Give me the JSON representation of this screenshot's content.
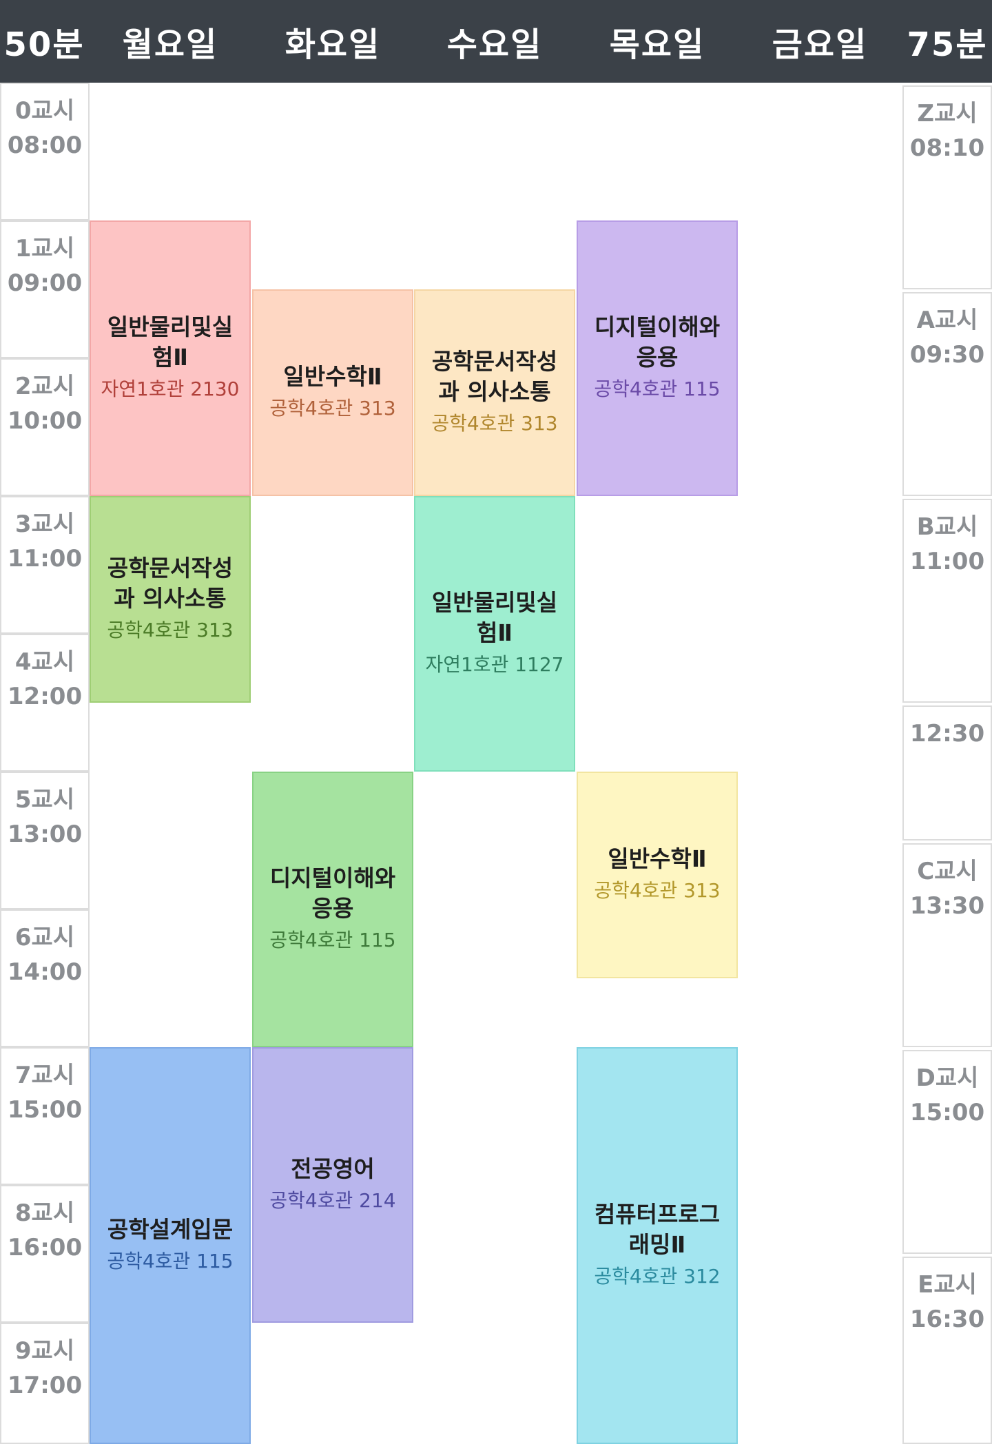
{
  "header": {
    "left_label": "50분",
    "days": [
      "월요일",
      "화요일",
      "수요일",
      "목요일",
      "금요일"
    ],
    "right_label": "75분"
  },
  "left_periods": [
    {
      "name": "0교시",
      "time": "08:00"
    },
    {
      "name": "1교시",
      "time": "09:00"
    },
    {
      "name": "2교시",
      "time": "10:00"
    },
    {
      "name": "3교시",
      "time": "11:00"
    },
    {
      "name": "4교시",
      "time": "12:00"
    },
    {
      "name": "5교시",
      "time": "13:00"
    },
    {
      "name": "6교시",
      "time": "14:00"
    },
    {
      "name": "7교시",
      "time": "15:00"
    },
    {
      "name": "8교시",
      "time": "16:00"
    },
    {
      "name": "9교시",
      "time": "17:00"
    }
  ],
  "right_periods": [
    {
      "name": "Z교시",
      "time": "08:10"
    },
    {
      "name": "A교시",
      "time": "09:30"
    },
    {
      "name": "B교시",
      "time": "11:00"
    },
    {
      "name": "",
      "time": "12:30"
    },
    {
      "name": "C교시",
      "time": "13:30"
    },
    {
      "name": "D교시",
      "time": "15:00"
    },
    {
      "name": "E교시",
      "time": "16:30"
    }
  ],
  "courses": [
    {
      "day": "월요일",
      "title": "일반물리및실험Ⅱ",
      "room": "자연1호관 2130",
      "start": "09:00",
      "end": "11:00",
      "bg": "#fdc4c4",
      "border": "#f3a7a7",
      "text_color": "#b0403a"
    },
    {
      "day": "화요일",
      "title": "일반수학Ⅱ",
      "room": "공학4호관 313",
      "start": "09:30",
      "end": "11:00",
      "bg": "#fed7c3",
      "border": "#f5c2a6",
      "text_color": "#b0613a"
    },
    {
      "day": "수요일",
      "title": "공학문서작성과 의사소통",
      "room": "공학4호관 313",
      "start": "09:30",
      "end": "11:00",
      "bg": "#fde7c4",
      "border": "#f5d6a4",
      "text_color": "#b0862c"
    },
    {
      "day": "목요일",
      "title": "디지털이해와응용",
      "room": "공학4호관 115",
      "start": "09:00",
      "end": "11:00",
      "bg": "#ccb8f0",
      "border": "#b79de6",
      "text_color": "#6a4aa7"
    },
    {
      "day": "월요일",
      "title": "공학문서작성과 의사소통",
      "room": "공학4호관 313",
      "start": "11:00",
      "end": "12:30",
      "bg": "#b8df92",
      "border": "#9fce74",
      "text_color": "#4a7a26"
    },
    {
      "day": "수요일",
      "title": "일반물리및실험Ⅱ",
      "room": "자연1호관 1127",
      "start": "11:00",
      "end": "13:00",
      "bg": "#9eeed0",
      "border": "#7fdfbb",
      "text_color": "#2e7d5f"
    },
    {
      "day": "화요일",
      "title": "디지털이해와응용",
      "room": "공학4호관 115",
      "start": "13:00",
      "end": "15:00",
      "bg": "#a5e3a0",
      "border": "#88d284",
      "text_color": "#3e7a3a"
    },
    {
      "day": "목요일",
      "title": "일반수학Ⅱ",
      "room": "공학4호관 313",
      "start": "13:00",
      "end": "14:30",
      "bg": "#fef6c2",
      "border": "#f2e5a0",
      "text_color": "#b2972a"
    },
    {
      "day": "월요일",
      "title": "공학설계입문",
      "room": "공학4호관 115",
      "start": "15:00",
      "end": "17:55",
      "bg": "#97bff3",
      "border": "#7eaae6",
      "text_color": "#2c5aa0"
    },
    {
      "day": "화요일",
      "title": "전공영어",
      "room": "공학4호관 214",
      "start": "15:00",
      "end": "17:00",
      "bg": "#b9b6ed",
      "border": "#a09be0",
      "text_color": "#4e4aa0"
    },
    {
      "day": "목요일",
      "title": "컴퓨터프로그래밍Ⅱ",
      "room": "공학4호관 312",
      "start": "15:00",
      "end": "17:55",
      "bg": "#a3e5f0",
      "border": "#7fd2e2",
      "text_color": "#2a8a9e"
    }
  ]
}
